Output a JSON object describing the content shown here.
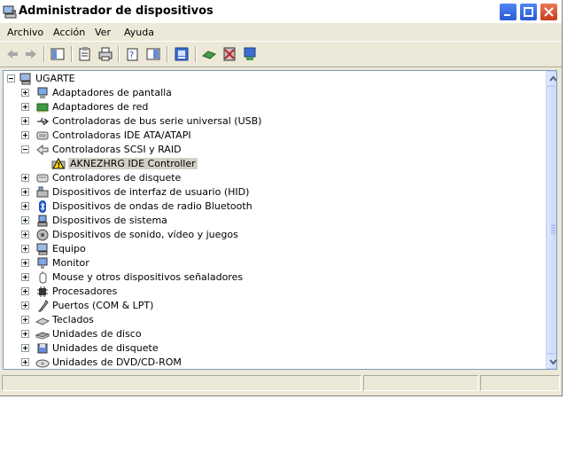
{
  "window": {
    "title": "Administrador de dispositivos"
  },
  "menu": [
    "Archivo",
    "Acción",
    "Ver",
    "Ayuda"
  ],
  "tree": {
    "root": "UGARTE",
    "items": [
      {
        "label": "Adaptadores de pantalla",
        "icon": "display-adapter-icon",
        "state": "collapsed"
      },
      {
        "label": "Adaptadores de red",
        "icon": "network-adapter-icon",
        "state": "collapsed"
      },
      {
        "label": "Controladoras de bus serie universal (USB)",
        "icon": "usb-icon",
        "state": "collapsed"
      },
      {
        "label": "Controladoras IDE ATA/ATAPI",
        "icon": "ide-controller-icon",
        "state": "collapsed"
      },
      {
        "label": "Controladoras SCSI y RAID",
        "icon": "scsi-icon",
        "state": "expanded",
        "children": [
          {
            "label": "AKNEZHRG IDE Controller",
            "icon": "warning-device-icon",
            "selected": true
          }
        ]
      },
      {
        "label": "Controladores de disquete",
        "icon": "floppy-controller-icon",
        "state": "collapsed"
      },
      {
        "label": "Dispositivos de interfaz de usuario (HID)",
        "icon": "hid-icon",
        "state": "collapsed"
      },
      {
        "label": "Dispositivos de ondas de radio Bluetooth",
        "icon": "bluetooth-icon",
        "state": "collapsed"
      },
      {
        "label": "Dispositivos de sistema",
        "icon": "system-device-icon",
        "state": "collapsed"
      },
      {
        "label": "Dispositivos de sonido, vídeo y juegos",
        "icon": "sound-icon",
        "state": "collapsed"
      },
      {
        "label": "Equipo",
        "icon": "computer-icon",
        "state": "collapsed"
      },
      {
        "label": "Monitor",
        "icon": "monitor-icon",
        "state": "collapsed"
      },
      {
        "label": "Mouse y otros dispositivos señaladores",
        "icon": "mouse-icon",
        "state": "collapsed"
      },
      {
        "label": "Procesadores",
        "icon": "processor-icon",
        "state": "collapsed"
      },
      {
        "label": "Puertos (COM & LPT)",
        "icon": "port-icon",
        "state": "collapsed"
      },
      {
        "label": "Teclados",
        "icon": "keyboard-icon",
        "state": "collapsed"
      },
      {
        "label": "Unidades de disco",
        "icon": "disk-drive-icon",
        "state": "collapsed"
      },
      {
        "label": "Unidades de disquete",
        "icon": "floppy-drive-icon",
        "state": "collapsed"
      },
      {
        "label": "Unidades de DVD/CD-ROM",
        "icon": "dvd-drive-icon",
        "state": "collapsed"
      }
    ]
  },
  "colors": {
    "selection": "#d4d0c8",
    "chrome": "#ece9d8",
    "border": "#7f9db9"
  }
}
